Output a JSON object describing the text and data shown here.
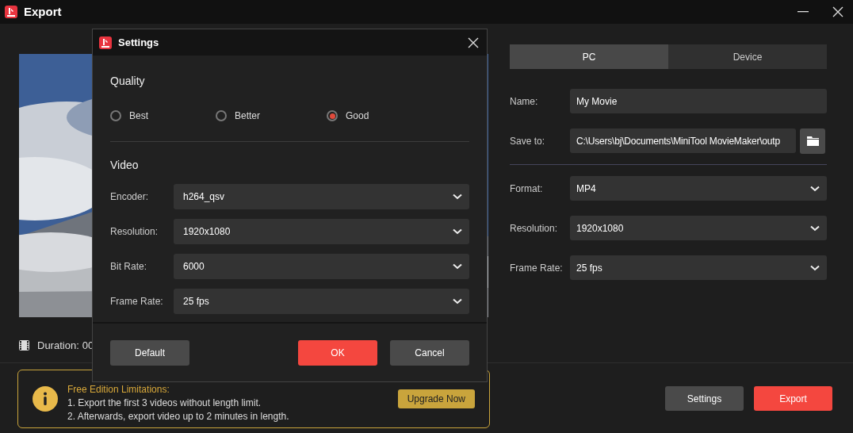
{
  "window": {
    "title": "Export"
  },
  "preview": {
    "duration_label": "Duration:",
    "duration_value": "00"
  },
  "target_tabs": [
    {
      "label": "PC",
      "selected": true
    },
    {
      "label": "Device",
      "selected": false
    }
  ],
  "fields": [
    {
      "label": "Name:",
      "value": "My Movie",
      "kind": "text"
    },
    {
      "label": "Save to:",
      "value": "C:\\Users\\bj\\Documents\\MiniTool MovieMaker\\outp",
      "kind": "path"
    },
    {
      "label": "Format:",
      "value": "MP4",
      "kind": "dropdown"
    },
    {
      "label": "Resolution:",
      "value": "1920x1080",
      "kind": "dropdown"
    },
    {
      "label": "Frame Rate:",
      "value": "25 fps",
      "kind": "dropdown"
    }
  ],
  "notice": {
    "title": "Free Edition Limitations:",
    "lines": [
      "1. Export the first 3 videos without length limit.",
      "2. Afterwards, export video up to 2 minutes in length."
    ],
    "button": "Upgrade Now"
  },
  "buttons": [
    "Settings",
    "Export"
  ],
  "settings_dialog": {
    "title": "Settings",
    "quality_heading": "Quality",
    "quality": [
      {
        "label": "Best",
        "selected": false
      },
      {
        "label": "Better",
        "selected": false
      },
      {
        "label": "Good",
        "selected": true
      }
    ],
    "video_heading": "Video",
    "video": [
      {
        "label": "Encoder:",
        "value": "h264_qsv"
      },
      {
        "label": "Resolution:",
        "value": "1920x1080"
      },
      {
        "label": "Bit Rate:",
        "value": "6000"
      },
      {
        "label": "Frame Rate:",
        "value": "25 fps"
      }
    ],
    "buttons": [
      "Default",
      "OK",
      "Cancel"
    ]
  }
}
